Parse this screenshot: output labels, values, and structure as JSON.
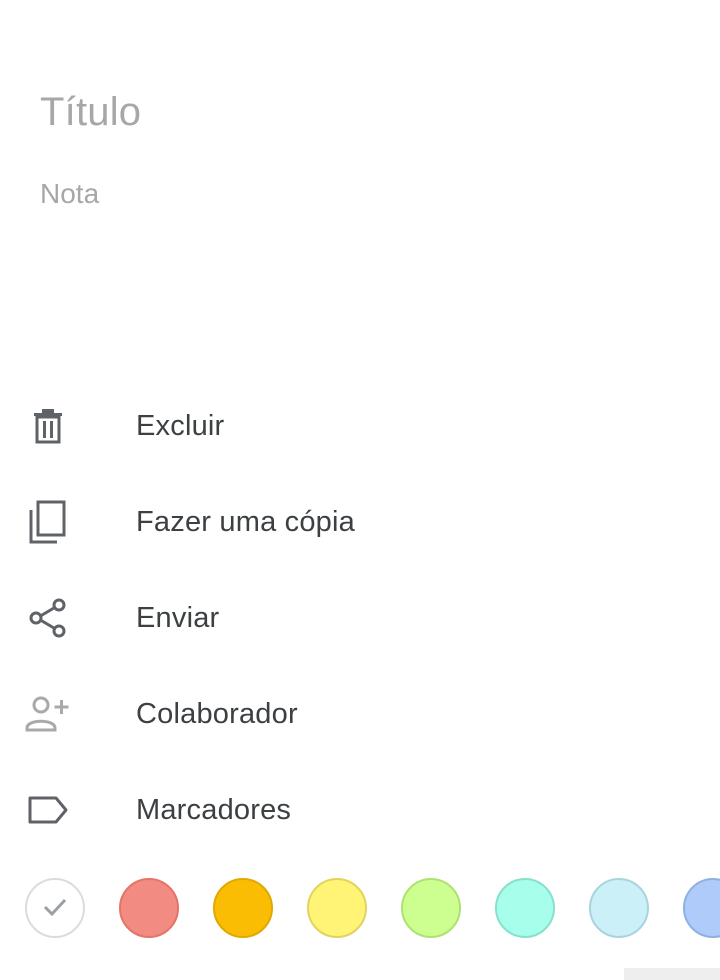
{
  "note": {
    "title_placeholder": "Título",
    "body_placeholder": "Nota"
  },
  "menu": {
    "items": [
      {
        "label": "Excluir",
        "icon": "trash-icon"
      },
      {
        "label": "Fazer uma cópia",
        "icon": "copy-icon"
      },
      {
        "label": "Enviar",
        "icon": "share-icon"
      },
      {
        "label": "Colaborador",
        "icon": "add-person-icon"
      },
      {
        "label": "Marcadores",
        "icon": "label-icon"
      }
    ]
  },
  "colors": {
    "selected_index": 0,
    "swatches": [
      {
        "name": "default",
        "fill": "#ffffff",
        "border": "#dadce0"
      },
      {
        "name": "red",
        "fill": "#f28b82",
        "border": "#e57368"
      },
      {
        "name": "orange",
        "fill": "#fbbc04",
        "border": "#e0a800"
      },
      {
        "name": "yellow",
        "fill": "#fff475",
        "border": "#e0d35e"
      },
      {
        "name": "green",
        "fill": "#ccff90",
        "border": "#b0e070"
      },
      {
        "name": "teal",
        "fill": "#a7ffeb",
        "border": "#86e0cb"
      },
      {
        "name": "blue",
        "fill": "#cbf0f8",
        "border": "#a8d4de"
      },
      {
        "name": "dark-blue",
        "fill": "#aecbfa",
        "border": "#8fb0e0"
      }
    ]
  }
}
